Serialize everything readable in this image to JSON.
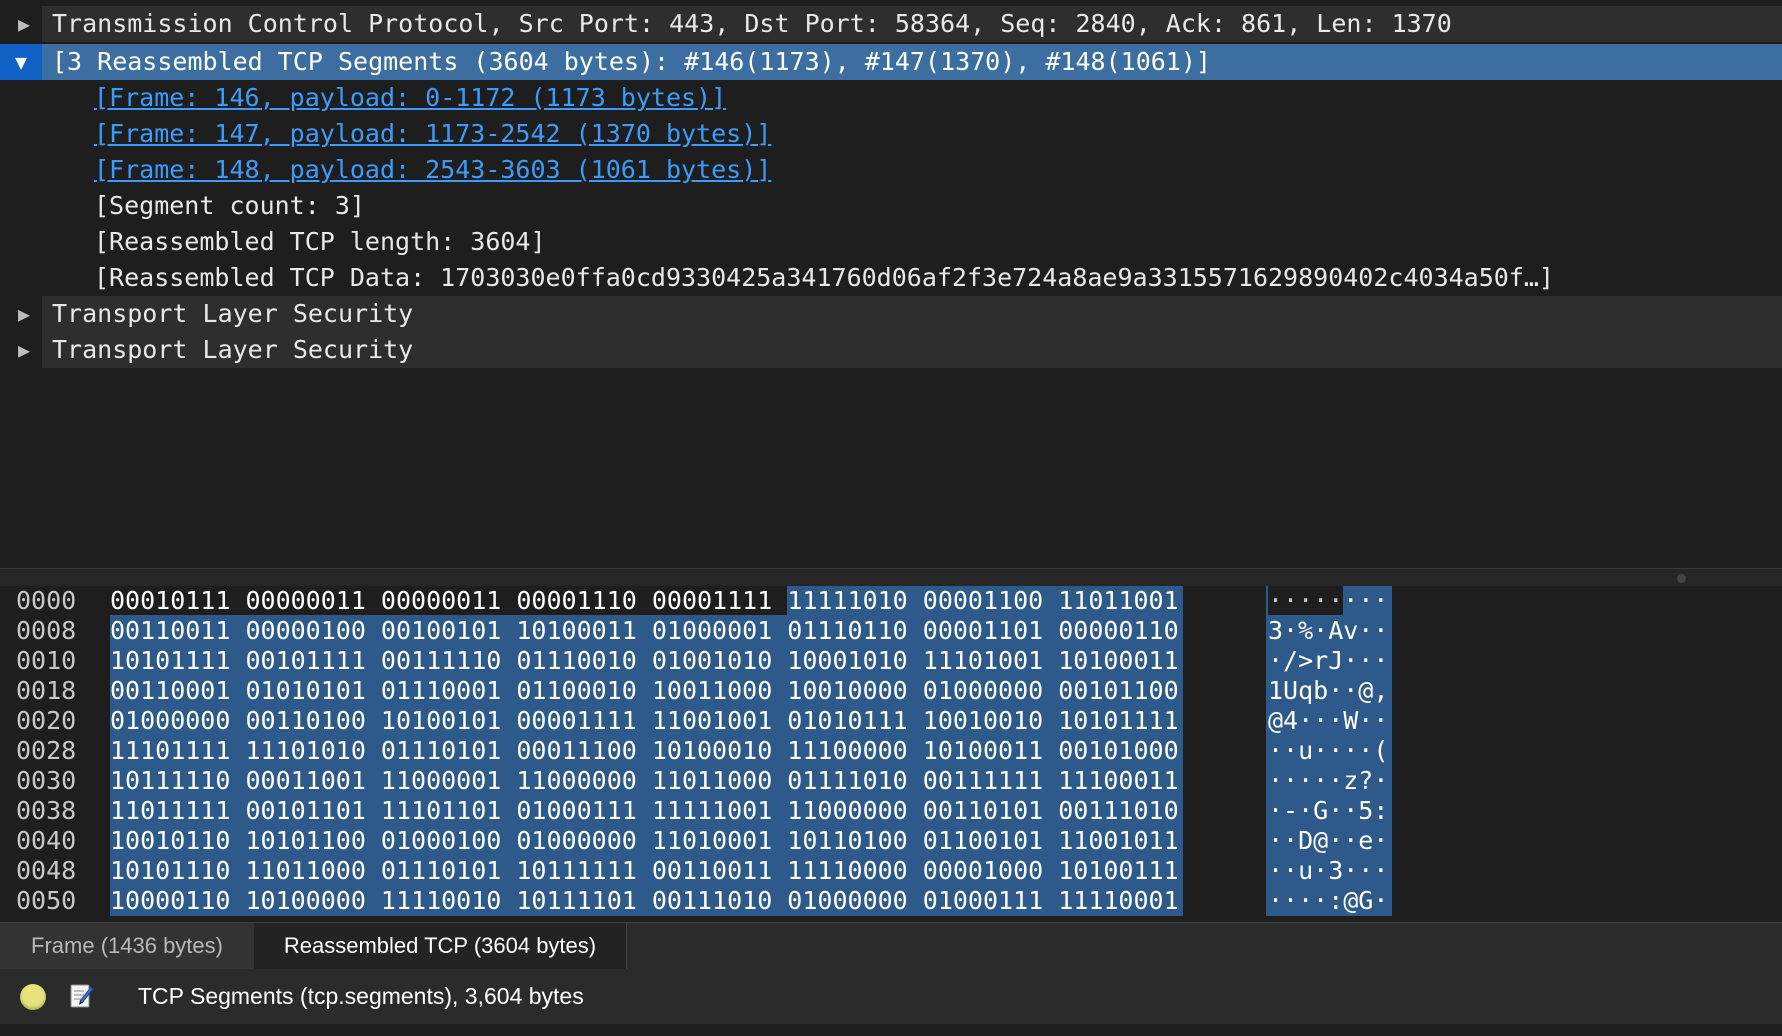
{
  "tree": {
    "rows": [
      {
        "label": "Transmission Control Protocol, Src Port: 443, Dst Port: 58364, Seq: 2840, Ack: 861, Len: 1370"
      },
      {
        "label": "[3 Reassembled TCP Segments (3604 bytes): #146(1173), #147(1370), #148(1061)]"
      },
      {
        "label": "[Frame: 146, payload: 0-1172 (1173 bytes)]"
      },
      {
        "label": "[Frame: 147, payload: 1173-2542 (1370 bytes)]"
      },
      {
        "label": "[Frame: 148, payload: 2543-3603 (1061 bytes)]"
      },
      {
        "label": "[Segment count: 3]"
      },
      {
        "label": "[Reassembled TCP length: 3604]"
      },
      {
        "label": "[Reassembled TCP Data: 1703030e0ffa0cd9330425a341760d06af2f3e724a8ae9a3315571629890402c4034a50f…]"
      },
      {
        "label": "Transport Layer Security"
      },
      {
        "label": "Transport Layer Security"
      }
    ],
    "expand_symbols": {
      "collapsed": "▶",
      "expanded": "▼"
    }
  },
  "hex": {
    "rows": [
      {
        "offset": "0000",
        "bytes_unsel": "00010111 00000011 00000011 00001110 00001111 ",
        "bytes_sel": "11111010 00001100 11011001",
        "ascii_unsel": "·····",
        "ascii_sel": "···"
      },
      {
        "offset": "0008",
        "bytes_unsel": "",
        "bytes_sel": "00110011 00000100 00100101 10100011 01000001 01110110 00001101 00000110",
        "ascii_unsel": "",
        "ascii_sel": "3·%·Av··"
      },
      {
        "offset": "0010",
        "bytes_unsel": "",
        "bytes_sel": "10101111 00101111 00111110 01110010 01001010 10001010 11101001 10100011",
        "ascii_unsel": "",
        "ascii_sel": "·/>rJ···"
      },
      {
        "offset": "0018",
        "bytes_unsel": "",
        "bytes_sel": "00110001 01010101 01110001 01100010 10011000 10010000 01000000 00101100",
        "ascii_unsel": "",
        "ascii_sel": "1Uqb··@,"
      },
      {
        "offset": "0020",
        "bytes_unsel": "",
        "bytes_sel": "01000000 00110100 10100101 00001111 11001001 01010111 10010010 10101111",
        "ascii_unsel": "",
        "ascii_sel": "@4···W··"
      },
      {
        "offset": "0028",
        "bytes_unsel": "",
        "bytes_sel": "11101111 11101010 01110101 00011100 10100010 11100000 10100011 00101000",
        "ascii_unsel": "",
        "ascii_sel": "··u····("
      },
      {
        "offset": "0030",
        "bytes_unsel": "",
        "bytes_sel": "10111110 00011001 11000001 11000000 11011000 01111010 00111111 11100011",
        "ascii_unsel": "",
        "ascii_sel": "·····z?·"
      },
      {
        "offset": "0038",
        "bytes_unsel": "",
        "bytes_sel": "11011111 00101101 11101101 01000111 11111001 11000000 00110101 00111010",
        "ascii_unsel": "",
        "ascii_sel": "·-·G··5:"
      },
      {
        "offset": "0040",
        "bytes_unsel": "",
        "bytes_sel": "10010110 10101100 01000100 01000000 11010001 10110100 01100101 11001011",
        "ascii_unsel": "",
        "ascii_sel": "··D@··e·"
      },
      {
        "offset": "0048",
        "bytes_unsel": "",
        "bytes_sel": "10101110 11011000 01110101 10111111 00110011 11110000 00001000 10100111",
        "ascii_unsel": "",
        "ascii_sel": "··u·3···"
      },
      {
        "offset": "0050",
        "bytes_unsel": "",
        "bytes_sel": "10000110 10100000 11110010 10111101 00111010 01000000 01000111 11110001",
        "ascii_unsel": "",
        "ascii_sel": "····:@G·"
      }
    ]
  },
  "tabs": {
    "frame_label": "Frame (1436 bytes)",
    "reassembled_label": "Reassembled TCP (3604 bytes)"
  },
  "status": {
    "text": "TCP Segments (tcp.segments), 3,604 bytes",
    "led_color": "#e7e27a"
  },
  "colors": {
    "selection_row": "#3c6ea2",
    "selection_hex": "#2d5a8a",
    "link": "#3b9cff"
  }
}
